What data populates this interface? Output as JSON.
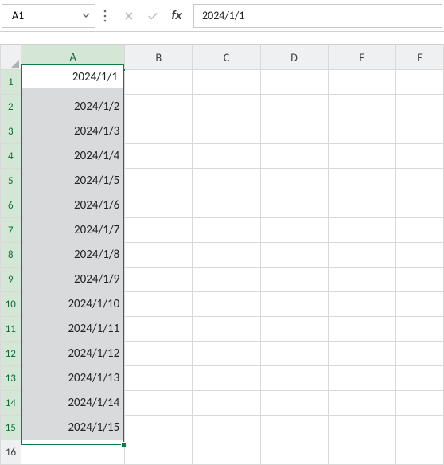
{
  "name_box": {
    "value": "A1"
  },
  "formula_bar": {
    "value": "2024/1/1"
  },
  "columns": [
    "A",
    "B",
    "C",
    "D",
    "E",
    "F"
  ],
  "selected_column": "A",
  "rows": [
    1,
    2,
    3,
    4,
    5,
    6,
    7,
    8,
    9,
    10,
    11,
    12,
    13,
    14,
    15,
    16
  ],
  "selected_rows": [
    1,
    2,
    3,
    4,
    5,
    6,
    7,
    8,
    9,
    10,
    11,
    12,
    13,
    14,
    15
  ],
  "active_cell": {
    "ref": "A1",
    "value": "2024/1/1"
  },
  "cells": {
    "A1": "2024/1/1",
    "A2": "2024/1/2",
    "A3": "2024/1/3",
    "A4": "2024/1/4",
    "A5": "2024/1/5",
    "A6": "2024/1/6",
    "A7": "2024/1/7",
    "A8": "2024/1/8",
    "A9": "2024/1/9",
    "A10": "2024/1/10",
    "A11": "2024/1/11",
    "A12": "2024/1/12",
    "A13": "2024/1/13",
    "A14": "2024/1/14",
    "A15": "2024/1/15"
  },
  "selection": {
    "start": "A1",
    "end": "A15"
  },
  "colors": {
    "accent": "#107c41"
  }
}
